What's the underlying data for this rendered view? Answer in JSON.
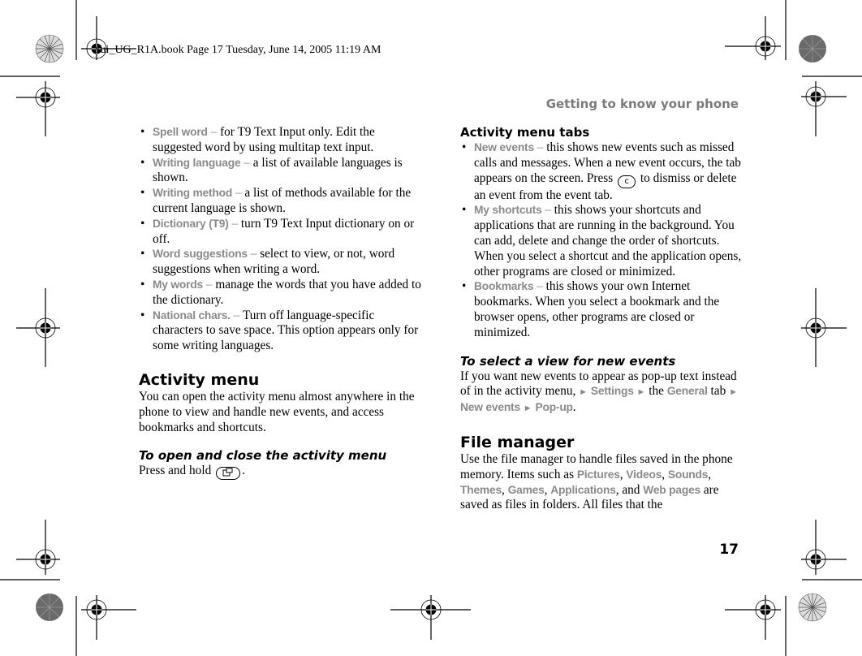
{
  "book_line": "Yui_UG_R1A.book  Page 17  Tuesday, June 14, 2005  11:19 AM",
  "running_head": "Getting to know your phone",
  "page_number": "17",
  "left_column": {
    "bullets": [
      {
        "term": "Spell word",
        "sep": " – ",
        "text": "for T9 Text Input only. Edit the suggested word by using multitap text input."
      },
      {
        "term": "Writing language",
        "sep": " – ",
        "text": "a list of available languages is shown."
      },
      {
        "term": "Writing method",
        "sep": " – ",
        "text": "a list of methods available for the current language is shown."
      },
      {
        "term": "Dictionary (T9)",
        "sep": " – ",
        "text": "turn T9 Text Input dictionary on or off."
      },
      {
        "term": "Word suggestions",
        "sep": " – ",
        "text": "select to view, or not, word suggestions when writing a word."
      },
      {
        "term": "My words",
        "sep": " – ",
        "text": "manage the words that you have added to the dictionary."
      },
      {
        "term": "National chars.",
        "sep": " – ",
        "text": "Turn off language-specific characters to save space. This option appears only for some writing languages."
      }
    ],
    "activity_menu": {
      "heading": "Activity menu",
      "body": "You can open the activity menu almost anywhere in the phone to view and handle new events, and access bookmarks and shortcuts."
    },
    "open_close": {
      "heading": "To open and close the activity menu",
      "text_before": "Press and hold ",
      "key_icon": "activity-menu-key-icon",
      "text_after": "."
    }
  },
  "right_column": {
    "tabs_heading": "Activity menu tabs",
    "tabs": [
      {
        "term": "New events",
        "sep": " – ",
        "text_before_key": "this shows new events such as missed calls and messages. When a new event occurs, the tab appears on the screen. Press ",
        "key": "c",
        "text_after_key": " to dismiss or delete an event from the event tab."
      },
      {
        "term": "My shortcuts",
        "sep": " – ",
        "text": "this shows your shortcuts and applications that are running in the background. You can add, delete and change the order of shortcuts. When you select a shortcut and the application opens, other programs are closed or minimized."
      },
      {
        "term": "Bookmarks",
        "sep": " – ",
        "text": "this shows your own Internet bookmarks. When you select a bookmark and the browser opens, other programs are closed or minimized."
      }
    ],
    "select_view": {
      "heading": "To select a view for new events",
      "text1": "If you want new events to appear as pop-up text instead of in the activity menu, ",
      "arrow": "►",
      "settings": "Settings",
      "text2": " the ",
      "general": "General",
      "text3": " tab ",
      "new_events": "New events",
      "popup": "Pop-up",
      "end": "."
    },
    "file_manager": {
      "heading": "File manager",
      "t1": "Use the file manager to handle files saved in the phone memory. Items such as ",
      "pictures": "Pictures",
      "c1": ", ",
      "videos": "Videos",
      "c2": ", ",
      "sounds": "Sounds",
      "c3": ", ",
      "themes": "Themes",
      "c4": ", ",
      "games": "Games",
      "c5": ", ",
      "applications": "Applications",
      "c6": ", and ",
      "web_pages": "Web pages",
      "t2": " are saved as files in folders. All files that the"
    }
  }
}
